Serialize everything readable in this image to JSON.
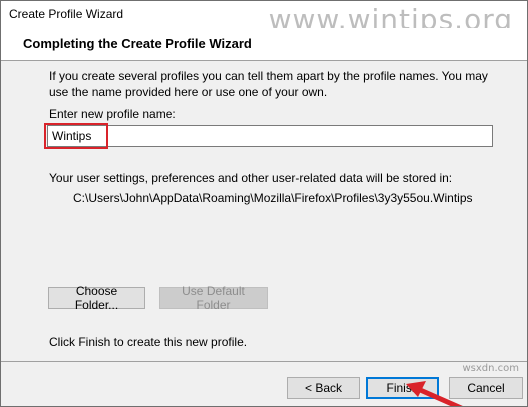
{
  "window": {
    "title": "Create Profile Wizard",
    "watermark": "www.wintips.org",
    "watermark_bottom": "wsxdn.com"
  },
  "header": {
    "title": "Completing the Create Profile Wizard"
  },
  "content": {
    "description": "If you create several profiles you can tell them apart by the profile names. You may use the name provided here or use one of your own.",
    "field_label": "Enter new profile name:",
    "profile_name_value": "Wintips",
    "storage_text": "Your user settings, preferences and other user-related data will be stored in:",
    "storage_path": "C:\\Users\\John\\AppData\\Roaming\\Mozilla\\Firefox\\Profiles\\3y3y55ou.Wintips",
    "choose_folder_label": "Choose Folder...",
    "use_default_folder_label": "Use Default Folder",
    "finish_note": "Click Finish to create this new profile."
  },
  "footer": {
    "back_label": "< Back",
    "finish_label": "Finish",
    "cancel_label": "Cancel"
  },
  "colors": {
    "highlight": "#d9232a",
    "accent": "#0078d7"
  }
}
